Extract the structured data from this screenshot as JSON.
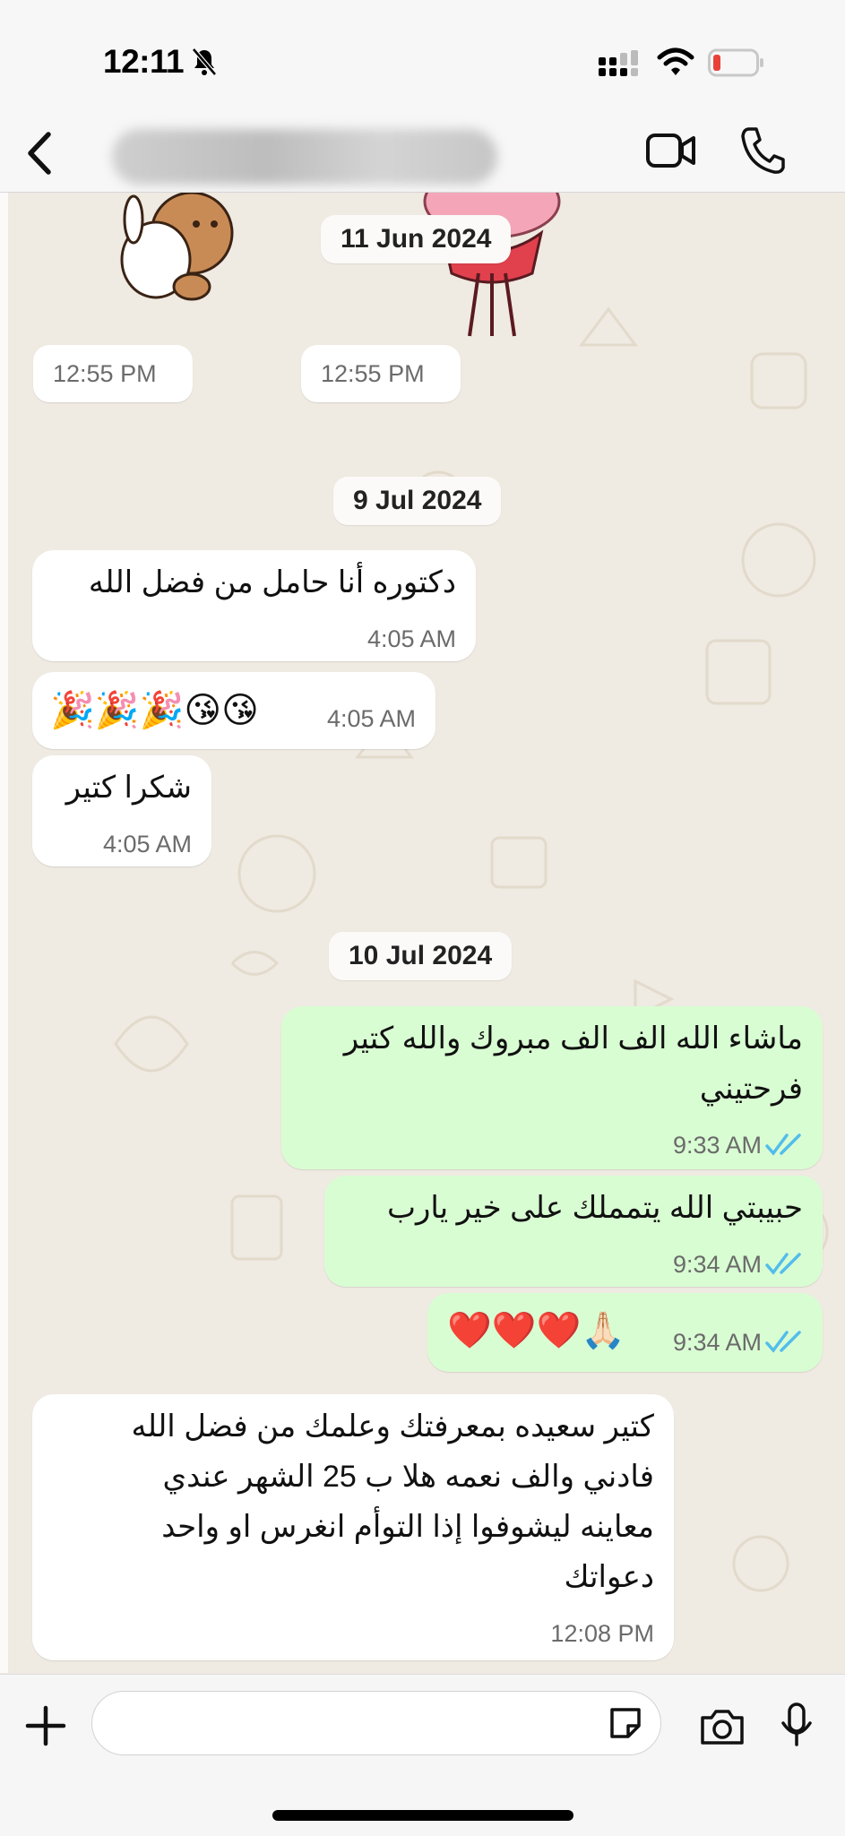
{
  "status": {
    "time": "12:11",
    "icons": [
      "bell-slash-icon",
      "cellular-icon",
      "wifi-icon",
      "battery-low-icon"
    ],
    "battery_color": "#e8413a"
  },
  "header": {
    "contact_name": "",
    "icons": [
      "back-icon",
      "video-call-icon",
      "voice-call-icon"
    ]
  },
  "chat": {
    "date_chips": [
      "11 Jun 2024",
      "9 Jul 2024",
      "10 Jul 2024"
    ],
    "stickers": [
      {
        "time": "12:55 PM",
        "subject": "teddy bear hugging bunny"
      },
      {
        "time": "12:55 PM",
        "subject": "pink haired girl"
      }
    ],
    "messages": [
      {
        "direction": "in",
        "text": "دكتوره أنا حامل من فضل الله",
        "time": "4:05 AM"
      },
      {
        "direction": "in",
        "text": "🎉🎉🎉😘😘",
        "time": "4:05 AM"
      },
      {
        "direction": "in",
        "text": "شكرا كتير",
        "time": "4:05 AM"
      },
      {
        "direction": "out",
        "lines": [
          "ماشاء الله الف الف مبروك والله كتير",
          "فرحتيني"
        ],
        "time": "9:33 AM",
        "status": "read"
      },
      {
        "direction": "out",
        "text": "حبيبتي الله يتمملك على خير يارب",
        "time": "9:34 AM",
        "status": "read"
      },
      {
        "direction": "out",
        "text": "❤️❤️❤️🙏🏻",
        "time": "9:34 AM",
        "status": "read"
      },
      {
        "direction": "in",
        "lines": [
          "كتير سعيده بمعرفتك وعلمك من فضل الله",
          "فادني والف نعمه هلا ب 25 الشهر عندي",
          "معاينه ليشوفوا إذا التوأم انغرس او واحد",
          "دعواتك"
        ],
        "time": "12:08 PM"
      }
    ]
  },
  "composer": {
    "placeholder": "",
    "icons": [
      "plus-icon",
      "sticker-icon",
      "camera-icon",
      "microphone-icon"
    ]
  },
  "colors": {
    "chat_bg": "#efeae2",
    "incoming_bubble": "#ffffff",
    "outgoing_bubble": "#d9fdd3",
    "read_ticks": "#53bdeb"
  }
}
